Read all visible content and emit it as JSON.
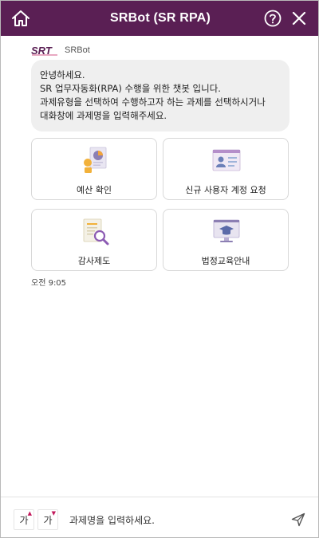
{
  "header": {
    "title": "SRBot (SR RPA)",
    "home_icon": "home-icon",
    "help_icon": "help-icon",
    "close_icon": "close-icon",
    "color": "#5a1f54"
  },
  "bot": {
    "logo_text": "SRT",
    "name": "SRBot"
  },
  "message": {
    "lines": [
      "안녕하세요.",
      "SR 업무자동화(RPA) 수행을 위한 챗봇 입니다.",
      "과제유형을 선택하여 수행하고자 하는 과제를 선택하시거나",
      "대화창에 과제명을 입력해주세요."
    ],
    "time": "오전 9:05"
  },
  "cards": [
    {
      "label": "예산 확인",
      "icon": "budget-chart-icon"
    },
    {
      "label": "신규 사용자 계정 요청",
      "icon": "user-account-icon"
    },
    {
      "label": "감사제도",
      "icon": "audit-search-icon"
    },
    {
      "label": "법정교육안내",
      "icon": "education-monitor-icon"
    }
  ],
  "footer": {
    "font_up_label": "가",
    "font_down_label": "가",
    "input_placeholder": "과제명을 입력하세요.",
    "send_icon": "send-icon"
  }
}
